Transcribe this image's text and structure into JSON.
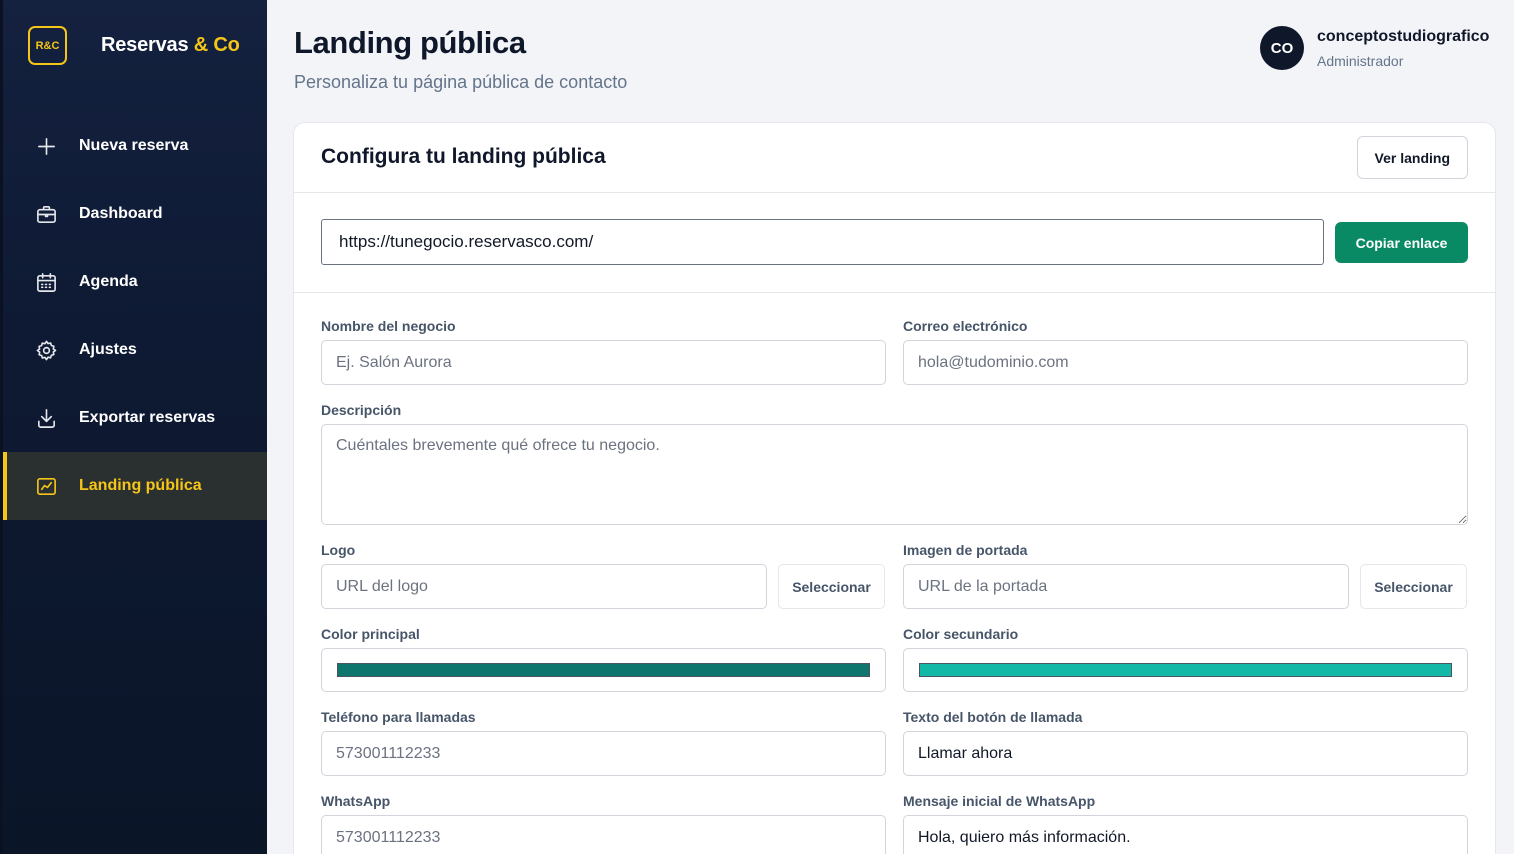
{
  "brand": {
    "mark": "R&C",
    "name": "Reservas",
    "name_accent": "& Co",
    "accent_color": "#f5c518"
  },
  "sidebar": {
    "items": [
      {
        "label": "Nueva reserva",
        "icon": "plus-icon"
      },
      {
        "label": "Dashboard",
        "icon": "briefcase-icon"
      },
      {
        "label": "Agenda",
        "icon": "calendar-icon"
      },
      {
        "label": "Ajustes",
        "icon": "gear-icon"
      },
      {
        "label": "Exportar reservas",
        "icon": "download-icon"
      },
      {
        "label": "Landing pública",
        "icon": "chart-icon",
        "active": true
      }
    ]
  },
  "header": {
    "title": "Landing pública",
    "subtitle": "Personaliza tu página pública de contacto"
  },
  "user": {
    "initials": "CO",
    "name": "conceptostudiografico",
    "role": "Administrador"
  },
  "card": {
    "title": "Configura tu landing pública",
    "view_button": "Ver landing",
    "url": "https://tunegocio.reservasco.com/",
    "copy_button": "Copiar enlace"
  },
  "form": {
    "business_name": {
      "label": "Nombre del negocio",
      "placeholder": "Ej. Salón Aurora"
    },
    "email": {
      "label": "Correo electrónico",
      "placeholder": "hola@tudominio.com"
    },
    "description": {
      "label": "Descripción",
      "placeholder": "Cuéntales brevemente qué ofrece tu negocio."
    },
    "logo": {
      "label": "Logo",
      "placeholder": "URL del logo",
      "button": "Seleccionar"
    },
    "cover": {
      "label": "Imagen de portada",
      "placeholder": "URL de la portada",
      "button": "Seleccionar"
    },
    "primary_color": {
      "label": "Color principal",
      "value": "#0f766e"
    },
    "secondary_color": {
      "label": "Color secundario",
      "value": "#14b8a6"
    },
    "phone": {
      "label": "Teléfono para llamadas",
      "placeholder": "573001112233"
    },
    "call_text": {
      "label": "Texto del botón de llamada",
      "value": "Llamar ahora"
    },
    "whatsapp": {
      "label": "WhatsApp",
      "placeholder": "573001112233"
    },
    "whatsapp_message": {
      "label": "Mensaje inicial de WhatsApp",
      "value": "Hola, quiero más información."
    }
  }
}
